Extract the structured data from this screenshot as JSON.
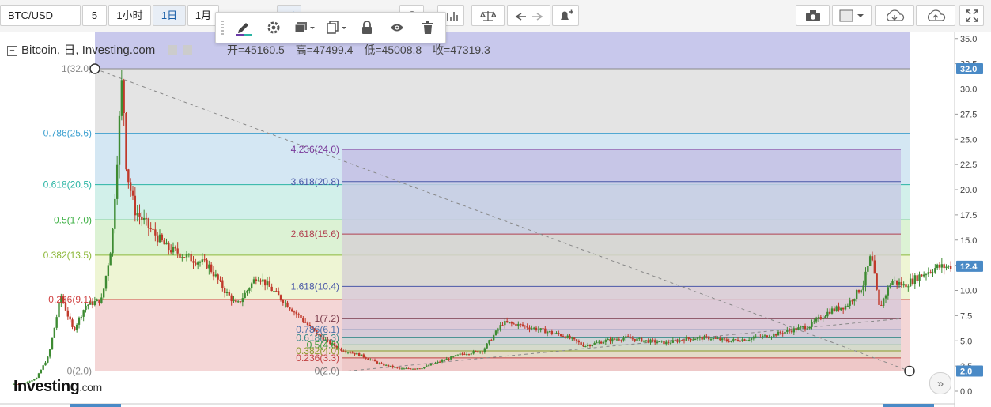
{
  "toolbar": {
    "symbol": "BTC/USD",
    "interval_value": "5",
    "timeframes": [
      "1小时",
      "1日",
      "1月"
    ],
    "active_timeframe": "1日"
  },
  "drawbar": {
    "tools": [
      "pencil-icon",
      "gear-icon",
      "layers-icon",
      "copy-icon",
      "lock-icon",
      "eye-icon",
      "trash-icon"
    ]
  },
  "header": {
    "title": "Bitcoin, 日, Investing.com",
    "open_label": "开=45160.5",
    "high_label": "高=47499.4",
    "low_label": "低=45008.8",
    "close_label": "收=47319.3"
  },
  "watermark": {
    "brand": "Investing",
    "suffix": ".com"
  },
  "colors": {
    "accent": "#4a8ac6",
    "up": "#3d8b32",
    "down": "#c0392b",
    "fib_outer_bg": "#c8c8ec",
    "fib_inner_bg": "#b8b8e0"
  },
  "chart_data": {
    "type": "candlestick",
    "title": "Bitcoin, 日, Investing.com",
    "ylim": [
      -1,
      35.5
    ],
    "y_ticks": [
      "35.0",
      "32.5",
      "30.0",
      "27.5",
      "25.0",
      "22.5",
      "20.0",
      "17.5",
      "15.0",
      "12.5",
      "10.0",
      "7.5",
      "5.0",
      "2.5",
      "0.0"
    ],
    "y_tick_values": [
      35,
      32.5,
      30,
      27.5,
      25,
      22.5,
      20,
      17.5,
      15,
      12.5,
      10,
      7.5,
      5,
      2.5,
      0
    ],
    "price_markers": [
      {
        "label": "32.0",
        "value": 32.0
      },
      {
        "label": "12.4",
        "value": 12.4
      },
      {
        "label": "2.0",
        "value": 2.0
      }
    ],
    "fib_retracement": {
      "levels": [
        {
          "label": "1(32.0)",
          "ratio": 1,
          "value": 32.0,
          "color": "#888888"
        },
        {
          "label": "0.786(25.6)",
          "ratio": 0.786,
          "value": 25.6,
          "color": "#3ca0d0"
        },
        {
          "label": "0.618(20.5)",
          "ratio": 0.618,
          "value": 20.5,
          "color": "#2bb5a4"
        },
        {
          "label": "0.5(17.0)",
          "ratio": 0.5,
          "value": 17.0,
          "color": "#3cb043"
        },
        {
          "label": "0.382(13.5)",
          "ratio": 0.382,
          "value": 13.5,
          "color": "#8db83a"
        },
        {
          "label": "0.236(9.1)",
          "ratio": 0.236,
          "value": 9.1,
          "color": "#d04040"
        },
        {
          "label": "0(2.0)",
          "ratio": 0,
          "value": 2.0,
          "color": "#888888"
        }
      ]
    },
    "fib_extension": {
      "levels": [
        {
          "label": "4.236(24.0)",
          "value": 24.0,
          "color": "#7a3a9a"
        },
        {
          "label": "3.618(20.8)",
          "value": 20.8,
          "color": "#4a58a8"
        },
        {
          "label": "2.618(15.6)",
          "value": 15.6,
          "color": "#b04050"
        },
        {
          "label": "1.618(10.4)",
          "value": 10.4,
          "color": "#4a58a8"
        },
        {
          "label": "1(7.2)",
          "value": 7.2,
          "color": "#7a3a4a"
        },
        {
          "label": "0.786(6.1)",
          "value": 6.1,
          "color": "#4a70a8"
        },
        {
          "label": "0.618(5.3)",
          "value": 5.3,
          "color": "#3a8a8a"
        },
        {
          "label": "0.5(4.6)",
          "value": 4.6,
          "color": "#3a9a3a"
        },
        {
          "label": "0.382(4.0)",
          "value": 4.0,
          "color": "#8a9a2a"
        },
        {
          "label": "0.236(3.3)",
          "value": 3.3,
          "color": "#c04040"
        },
        {
          "label": "0(2.0)",
          "value": 2.0,
          "color": "#777777"
        }
      ]
    },
    "price_path": [
      [
        0,
        0.7
      ],
      [
        0.03,
        0.8
      ],
      [
        0.06,
        1.3
      ],
      [
        0.09,
        3.5
      ],
      [
        0.12,
        9.5
      ],
      [
        0.15,
        6.0
      ],
      [
        0.18,
        8.5
      ],
      [
        0.2,
        8.8
      ],
      [
        0.22,
        9.1
      ],
      [
        0.245,
        15.0
      ],
      [
        0.26,
        25.0
      ],
      [
        0.27,
        31.5
      ],
      [
        0.28,
        22.0
      ],
      [
        0.3,
        18.0
      ],
      [
        0.34,
        16.0
      ],
      [
        0.38,
        14.2
      ],
      [
        0.43,
        13.3
      ],
      [
        0.48,
        12.5
      ],
      [
        0.52,
        10.0
      ],
      [
        0.55,
        8.5
      ],
      [
        0.6,
        11.5
      ],
      [
        0.65,
        9.5
      ],
      [
        0.7,
        7.5
      ],
      [
        0.75,
        5.5
      ],
      [
        0.8,
        4.2
      ],
      [
        0.85,
        3.6
      ],
      [
        0.9,
        2.7
      ],
      [
        0.95,
        2.2
      ],
      [
        1.0,
        2.3
      ],
      [
        1.05,
        3.0
      ],
      [
        1.1,
        3.7
      ],
      [
        1.15,
        4.0
      ],
      [
        1.2,
        6.8
      ],
      [
        1.25,
        6.5
      ],
      [
        1.3,
        6.0
      ],
      [
        1.35,
        5.5
      ],
      [
        1.4,
        4.5
      ],
      [
        1.45,
        5.0
      ],
      [
        1.5,
        5.3
      ],
      [
        1.55,
        5.0
      ],
      [
        1.6,
        4.8
      ],
      [
        1.65,
        5.2
      ],
      [
        1.7,
        5.3
      ],
      [
        1.75,
        5.0
      ],
      [
        1.8,
        5.2
      ],
      [
        1.85,
        5.5
      ],
      [
        1.9,
        6.0
      ],
      [
        1.95,
        6.5
      ],
      [
        2.0,
        8.0
      ],
      [
        2.04,
        8.5
      ],
      [
        2.08,
        10.5
      ],
      [
        2.1,
        13.5
      ],
      [
        2.12,
        8.2
      ],
      [
        2.15,
        11.0
      ],
      [
        2.18,
        10.5
      ],
      [
        2.22,
        11.5
      ],
      [
        2.26,
        12.3
      ],
      [
        2.3,
        12.4
      ]
    ]
  }
}
